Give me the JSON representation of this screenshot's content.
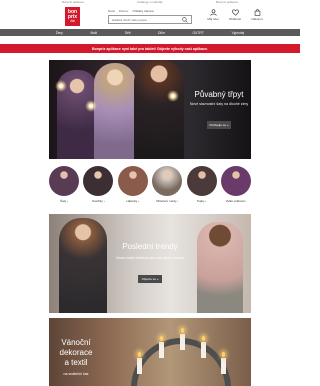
{
  "topbar": {
    "left": "Bonprix aplikace",
    "mid": "Katalogy a nabídky",
    "right": "Bonprix aplikace"
  },
  "header": {
    "logo": {
      "line1": "bon",
      "line2": "prix",
      "line3": "ČR"
    },
    "subnav": [
      "Nové",
      "Pomoc",
      "Ohlášky zákona"
    ],
    "search": {
      "placeholder": "Hledání zboží nebo pojmu"
    },
    "icons": [
      {
        "icon": "user-icon",
        "label": "Můj účet"
      },
      {
        "icon": "heart-icon",
        "label": "Oblíbené"
      },
      {
        "icon": "bag-icon",
        "label": "Nákupní"
      }
    ]
  },
  "catnav": [
    "Ženy",
    "Muži",
    "Děti",
    "Dům",
    "OUTFIT",
    "Výprodej"
  ],
  "promo": {
    "text": "Bonprix aplikace nyní také pro tablet! Objevte výhody naší aplikace."
  },
  "hero1": {
    "title": "Půvabný třpyt",
    "subtitle": "Nové slavnostní šaty na dlouhé zimy",
    "button": "Podívejte se »"
  },
  "circles": [
    {
      "label": "Šaty ›",
      "color": "#5a3b55"
    },
    {
      "label": "Svetříky ›",
      "color": "#3b2f33"
    },
    {
      "label": "Halenky ›",
      "color": "#8a5a4a"
    },
    {
      "label": "Oblečení módy ›",
      "color": "#d7cfc7"
    },
    {
      "label": "Topky ›",
      "color": "#4a3b3a"
    },
    {
      "label": "Velké velikosti ›",
      "color": "#6a3a6a"
    }
  ],
  "hero2": {
    "title": "Poslední trendy",
    "subtitle": "Nová modní kolekce pro tuto zimní sezónu",
    "button": "Objevte se »"
  },
  "hero3": {
    "title_lines": [
      "Vánoční",
      "dekorace",
      "a textil"
    ],
    "subtitle": "na sváteční čas"
  }
}
